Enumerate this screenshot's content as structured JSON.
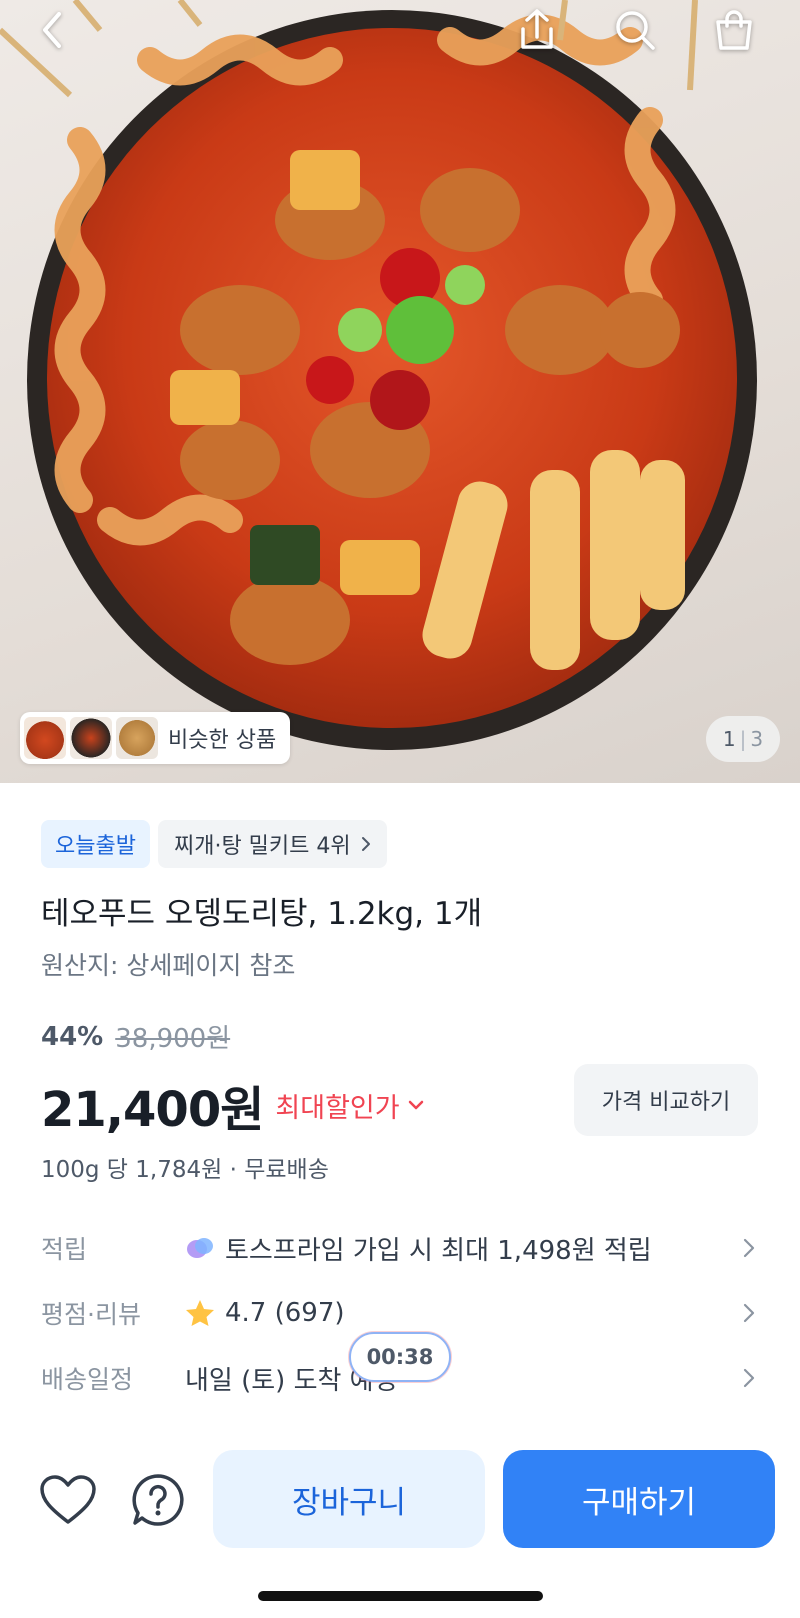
{
  "hero": {
    "image_description_icon": "product-photo",
    "similar_label": "비슷한 상품",
    "image_index": "1",
    "image_separator": "|",
    "image_total": "3"
  },
  "top_nav": {
    "icons": [
      "back-icon",
      "share-icon",
      "search-icon",
      "cart-bag-icon"
    ]
  },
  "tags": {
    "delivery": "오늘출발",
    "ranking": "찌개·탕 밀키트 4위"
  },
  "product": {
    "title": "테오푸드 오뎅도리탕, 1.2kg, 1개",
    "origin": "원산지: 상세페이지 참조",
    "discount": "44%",
    "original_price": "38,900원",
    "price": "21,400원",
    "max_discount_label": "최대할인가",
    "compare_label": "가격 비교하기",
    "unit_price": "100g 당 1,784원 · 무료배송"
  },
  "info_rows": {
    "points": {
      "label": "적립",
      "value": "토스프라임 가입 시 최대 1,498원 적립"
    },
    "rating": {
      "label": "평점·리뷰",
      "value": "4.7 (697)"
    },
    "shipping": {
      "label": "배송일정",
      "value": "내일 (토) 도착 예정"
    }
  },
  "timer": "00:38",
  "bottom_bar": {
    "cart_label": "장바구니",
    "buy_label": "구매하기"
  },
  "colors": {
    "brand_blue": "#3182f6",
    "accent_red": "#f04452",
    "tag_bg_blue": "#e8f3ff",
    "star_yellow": "#ffc342"
  }
}
